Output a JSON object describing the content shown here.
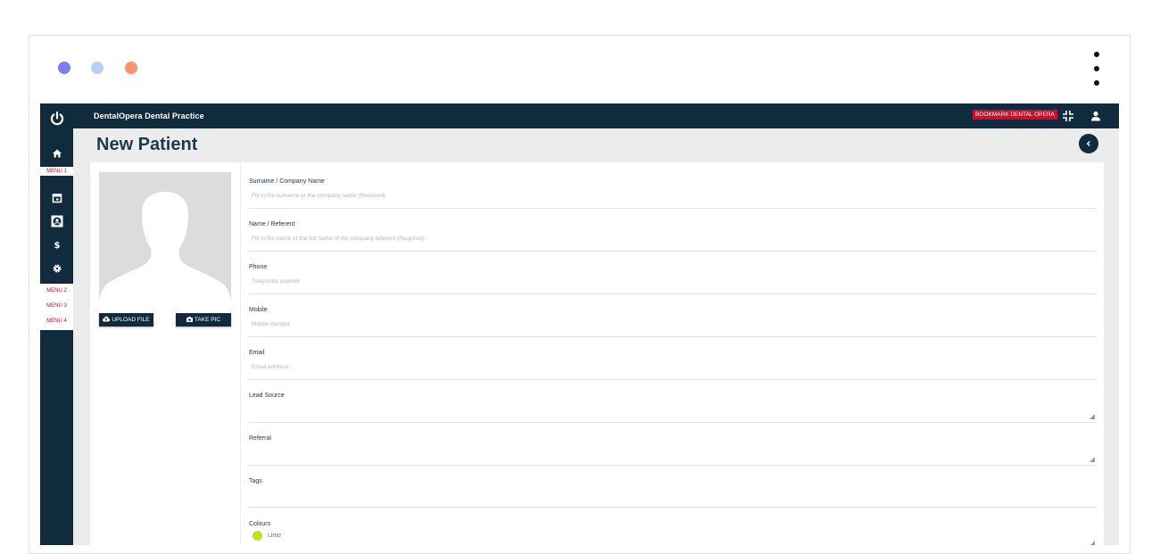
{
  "app": {
    "brand": "DentalOpera Dental Practice",
    "bookmark_label": "BOOKMARK DENTAL OPERA",
    "page_title": "New Patient"
  },
  "window_dots": {
    "colors": [
      "#7b7ff0",
      "#b9cffb",
      "#fb9373"
    ]
  },
  "sidebar": {
    "menus": [
      {
        "label": "MENU 1"
      },
      {
        "label": "MENU 2"
      },
      {
        "label": "MENU 3"
      },
      {
        "label": "MENU 4"
      }
    ],
    "icons": [
      "power-icon",
      "home-icon",
      "calendar-icon",
      "patient-icon",
      "dollar-icon",
      "gear-icon"
    ]
  },
  "photo": {
    "upload_label": "UPLOAD FILE",
    "take_pic_label": "TAKE PIC"
  },
  "form": {
    "surname": {
      "label": "Surname / Company Name",
      "placeholder": "Fill in the surname or the company name (Required)"
    },
    "name": {
      "label": "Name / Referent",
      "placeholder": "Fill in the name or the full name of the company referent (Required)"
    },
    "phone": {
      "label": "Phone",
      "placeholder": "Telephone number"
    },
    "mobile": {
      "label": "Mobile",
      "placeholder": "Mobile number"
    },
    "email": {
      "label": "Email",
      "placeholder": "Email address"
    },
    "lead_source": {
      "label": "Lead Source"
    },
    "referral": {
      "label": "Referral"
    },
    "tags": {
      "label": "Tags"
    },
    "colours": {
      "label": "Colours",
      "value": "Lime",
      "color": "#c8df1f"
    }
  },
  "colors": {
    "navy": "#0f2b3d",
    "accent_red": "#c8102e",
    "background": "#ececec"
  }
}
